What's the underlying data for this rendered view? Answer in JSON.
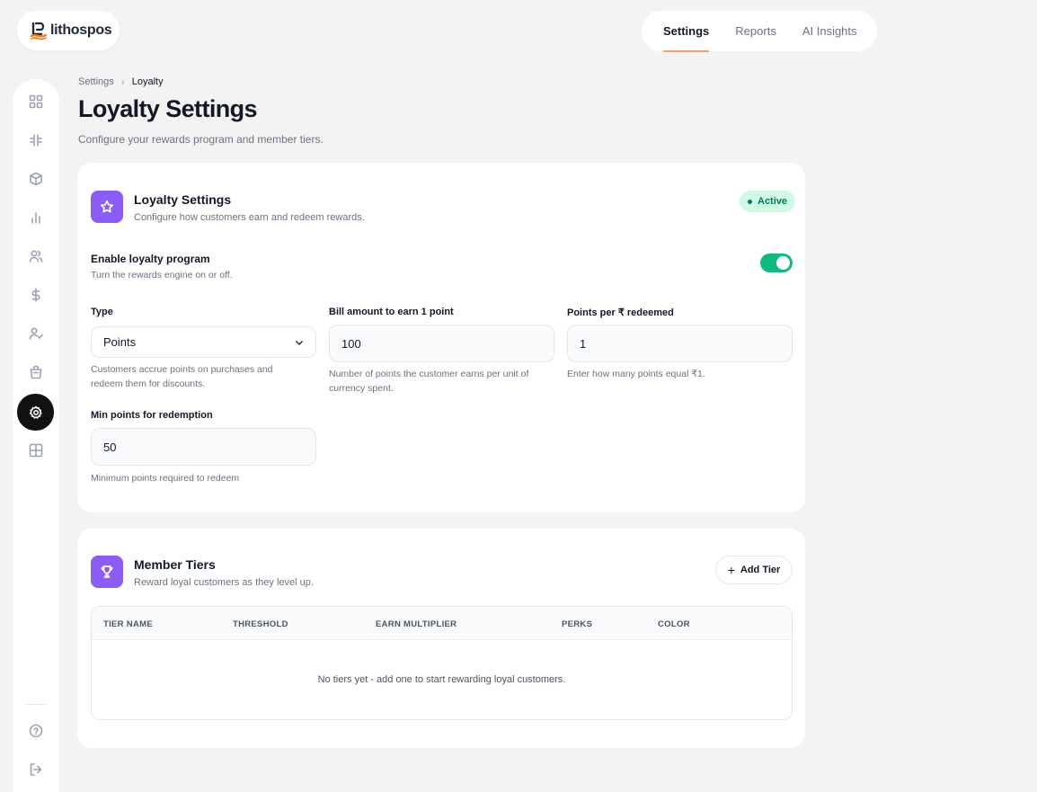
{
  "brand": {
    "name": "lithospos",
    "accent": "#f59e6b"
  },
  "topnav": {
    "tabs": [
      {
        "label": "Settings",
        "active": true
      },
      {
        "label": "Reports"
      },
      {
        "label": "AI Insights"
      }
    ]
  },
  "sidebar": {
    "items": [
      {
        "icon": "dashboard-icon"
      },
      {
        "icon": "hash-icon"
      },
      {
        "icon": "box-icon"
      },
      {
        "icon": "bar-chart-icon"
      },
      {
        "icon": "users-icon"
      },
      {
        "icon": "dollar-icon"
      },
      {
        "icon": "user-check-icon"
      },
      {
        "icon": "shopping-bag-icon"
      },
      {
        "icon": "gear-icon",
        "active": true
      },
      {
        "icon": "layout-grid-icon"
      }
    ],
    "footer": [
      {
        "icon": "help-icon"
      },
      {
        "icon": "logout-icon"
      }
    ]
  },
  "breadcrumb": {
    "parent": "Settings",
    "separator": "›",
    "current": "Loyalty"
  },
  "page": {
    "title": "Loyalty Settings",
    "subtitle": "Configure your rewards program and member tiers."
  },
  "loyalty_card": {
    "title": "Loyalty Settings",
    "subtitle": "Configure how customers earn and redeem rewards.",
    "status": "Active",
    "status_color": "#047857",
    "enable": {
      "label": "Enable loyalty program",
      "help": "Turn the rewards engine on or off.",
      "on": true
    },
    "fields": {
      "type": {
        "label": "Type",
        "value": "Points",
        "help": "Customers accrue points on purchases and redeem them for discounts."
      },
      "bill_amount": {
        "label": "Bill amount to earn 1 point",
        "value": "100",
        "help": "Number of points the customer earns per unit of currency spent."
      },
      "points_per_rupee": {
        "label": "Points per ₹ redeemed",
        "value": "1",
        "help": "Enter how many points equal ₹1."
      },
      "min_points": {
        "label": "Min points for redemption",
        "value": "50",
        "help": "Minimum points required to redeem"
      }
    }
  },
  "tiers_card": {
    "title": "Member Tiers",
    "subtitle": "Reward loyal customers as they level up.",
    "add_button": "Add Tier",
    "columns": [
      "TIER NAME",
      "THRESHOLD",
      "EARN MULTIPLIER",
      "PERKS",
      "COLOR"
    ],
    "empty_message": "No tiers yet - add one to start rewarding loyal customers."
  },
  "colors": {
    "toggle_on": "#10b981",
    "icon_bg": "#8b5cf6",
    "badge_bg": "#d1fae5"
  }
}
